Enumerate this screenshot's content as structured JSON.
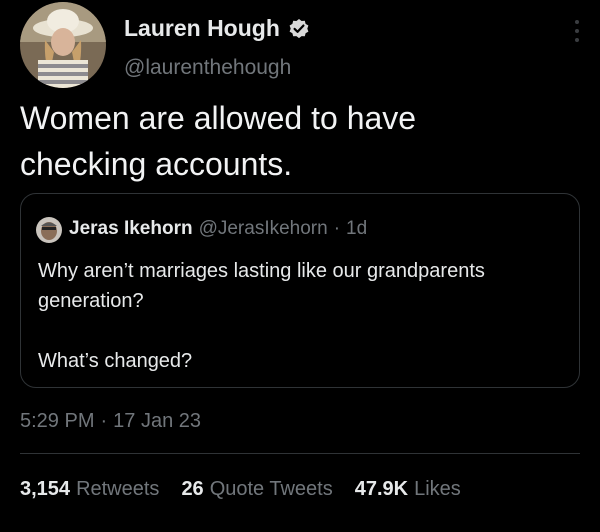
{
  "author": {
    "name": "Lauren Hough",
    "handle": "@laurenthehough",
    "verified": true
  },
  "tweet": {
    "text": "Women are allowed to have\nchecking accounts.",
    "time": "5:29 PM",
    "separator": "·",
    "date": "17 Jan 23"
  },
  "quote": {
    "name": "Jeras Ikehorn",
    "handle": "@JerasIkehorn",
    "separator": "·",
    "age": "1d",
    "line1": "Why aren’t marriages lasting like our grandparents generation?",
    "line2": "What’s changed?"
  },
  "stats": {
    "retweets": {
      "count": "3,154",
      "label": "Retweets"
    },
    "quotes": {
      "count": "26",
      "label": "Quote Tweets"
    },
    "likes": {
      "count": "47.9K",
      "label": "Likes"
    }
  },
  "colors": {
    "background": "#000000",
    "text": "#e7e9ea",
    "secondary": "#71767b",
    "verified": "#d9d9d9",
    "border": "#2f3336"
  },
  "icons": {
    "verified": "verified-badge-icon",
    "more": "more-vertical-icon"
  }
}
